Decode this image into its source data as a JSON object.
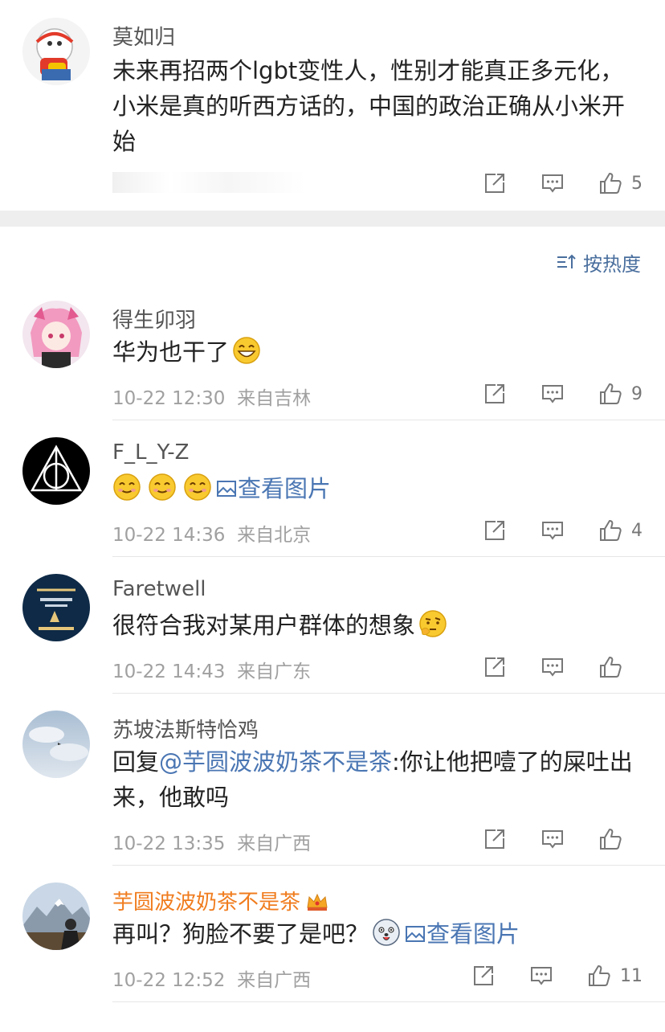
{
  "top_comment": {
    "name": "莫如归",
    "text": "未来再招两个lgbt变性人，性别才能真正多元化，小米是真的听西方话的，中国的政治正确从小米开始",
    "likes": "5"
  },
  "sort": {
    "label": "按热度"
  },
  "comments": [
    {
      "name": "得生卯羽",
      "text": "华为也干了",
      "time": "10-22 12:30",
      "location": "来自吉林",
      "likes": "9"
    },
    {
      "name": "F_L_Y-Z",
      "view_pic": "查看图片",
      "time": "10-22 14:36",
      "location": "来自北京",
      "likes": "4"
    },
    {
      "name": "Faretwell",
      "text": "很符合我对某用户群体的想象",
      "time": "10-22 14:43",
      "location": "来自广东",
      "likes": ""
    },
    {
      "name": "苏坡法斯特恰鸡",
      "reply_prefix": "回复",
      "mention": "@芋圆波波奶茶不是茶",
      "text": ":你让他把噎了的屎吐出来，他敢吗",
      "time": "10-22 13:35",
      "location": "来自广西",
      "likes": ""
    },
    {
      "name": "芋圆波波奶茶不是茶",
      "text": "再叫？狗脸不要了是吧？",
      "view_pic": "查看图片",
      "time": "10-22 12:52",
      "location": "来自广西",
      "likes": "11"
    }
  ],
  "colors": {
    "link": "#4a76b3",
    "vip_name": "#f07c1e",
    "meta": "#a0a0a0",
    "band": "#eeeeee"
  }
}
